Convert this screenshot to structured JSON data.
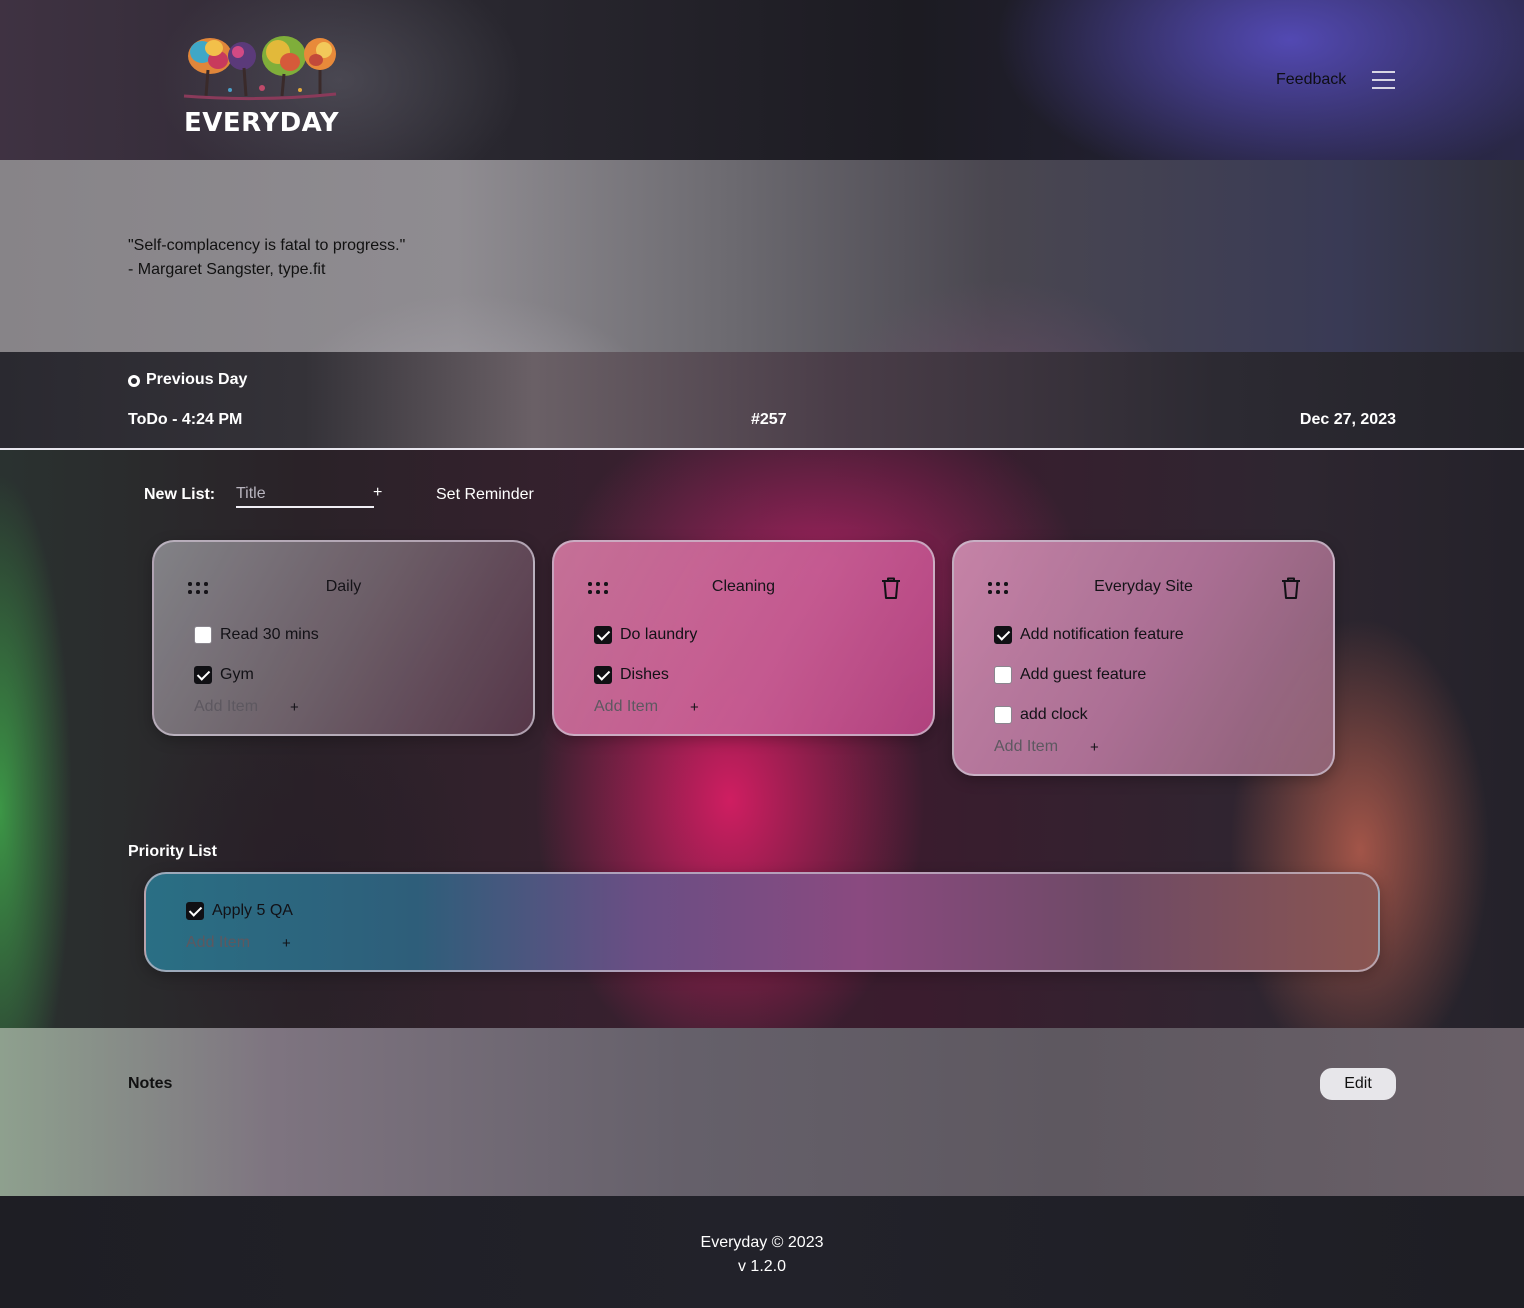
{
  "header": {
    "logo_text": "EVERYDAY",
    "feedback_label": "Feedback"
  },
  "quote": {
    "text": "\"Self-complacency is fatal to progress.\"",
    "attribution": "- Margaret Sangster, type.fit"
  },
  "day": {
    "previous_label": "Previous Day",
    "todo_time": "ToDo - 4:24 PM",
    "number": "#257",
    "date": "Dec 27, 2023"
  },
  "new_list": {
    "label": "New List:",
    "placeholder": "Title",
    "add_symbol": "+",
    "reminder_label": "Set Reminder"
  },
  "lists": [
    {
      "title": "Daily",
      "items": [
        {
          "label": "Read 30 mins",
          "checked": false
        },
        {
          "label": "Gym",
          "checked": true
        }
      ],
      "add_item_placeholder": "Add Item",
      "add_symbol": "+"
    },
    {
      "title": "Cleaning",
      "items": [
        {
          "label": "Do laundry",
          "checked": true
        },
        {
          "label": "Dishes",
          "checked": true
        }
      ],
      "add_item_placeholder": "Add Item",
      "add_symbol": "+"
    },
    {
      "title": "Everyday Site",
      "items": [
        {
          "label": "Add notification feature",
          "checked": true
        },
        {
          "label": "Add guest feature",
          "checked": false
        },
        {
          "label": "add clock",
          "checked": false
        }
      ],
      "add_item_placeholder": "Add Item",
      "add_symbol": "+"
    }
  ],
  "priority": {
    "label": "Priority List",
    "items": [
      {
        "label": "Apply 5 QA",
        "checked": true
      }
    ],
    "add_item_placeholder": "Add Item",
    "add_symbol": "+"
  },
  "notes": {
    "label": "Notes",
    "edit_label": "Edit"
  },
  "footer": {
    "copyright": "Everyday © 2023",
    "version": "v 1.2.0"
  },
  "icons": {
    "menu": "hamburger-menu-icon",
    "previous": "previous-day-icon",
    "drag": "drag-handle-icon",
    "trash": "trash-icon",
    "checkbox": "checkbox-icon"
  }
}
